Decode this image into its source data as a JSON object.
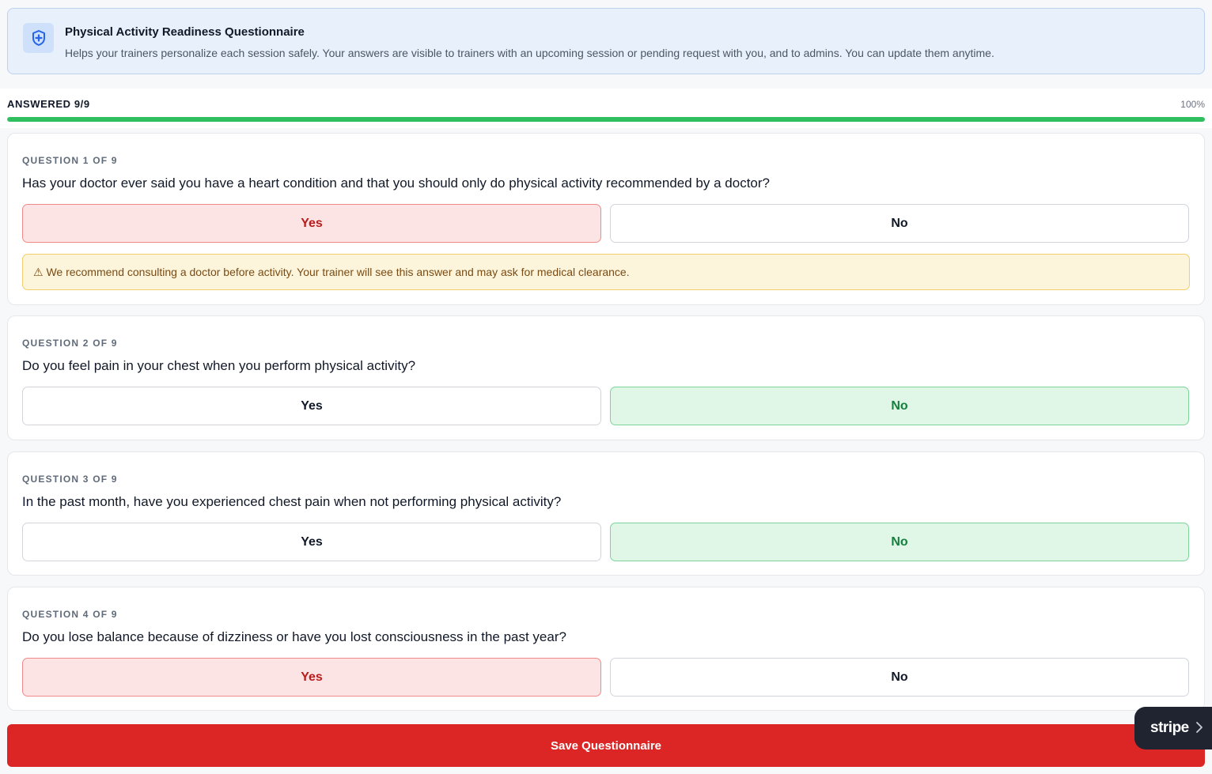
{
  "banner": {
    "title": "Physical Activity Readiness Questionnaire",
    "description": "Helps your trainers personalize each session safely. Your answers are visible to trainers with an upcoming session or pending request with you, and to admins. You can update them anytime.",
    "icon": "shield-plus-icon"
  },
  "progress": {
    "label": "ANSWERED 9/9",
    "percent_text": "100%",
    "fraction": 1.0
  },
  "questions": [
    {
      "kicker": "QUESTION 1 OF 9",
      "text": "Has your doctor ever said you have a heart condition and that you should only do physical activity recommended by a doctor?",
      "yes_label": "Yes",
      "no_label": "No",
      "selected": "yes",
      "warning": "⚠ We recommend consulting a doctor before activity. Your trainer will see this answer and may ask for medical clearance."
    },
    {
      "kicker": "QUESTION 2 OF 9",
      "text": "Do you feel pain in your chest when you perform physical activity?",
      "yes_label": "Yes",
      "no_label": "No",
      "selected": "no"
    },
    {
      "kicker": "QUESTION 3 OF 9",
      "text": "In the past month, have you experienced chest pain when not performing physical activity?",
      "yes_label": "Yes",
      "no_label": "No",
      "selected": "no"
    },
    {
      "kicker": "QUESTION 4 OF 9",
      "text": "Do you lose balance because of dizziness or have you lost consciousness in the past year?",
      "yes_label": "Yes",
      "no_label": "No",
      "selected": "yes"
    }
  ],
  "save_button": {
    "label": "Save Questionnaire"
  },
  "stripe_badge": {
    "label": "stripe",
    "icon": "chevron-right-icon"
  },
  "colors": {
    "accent_red": "#dc2626",
    "progress_green": "#2fbf5f",
    "selected_yes_bg": "#fde4e4",
    "selected_no_bg": "#e0f6e6"
  }
}
